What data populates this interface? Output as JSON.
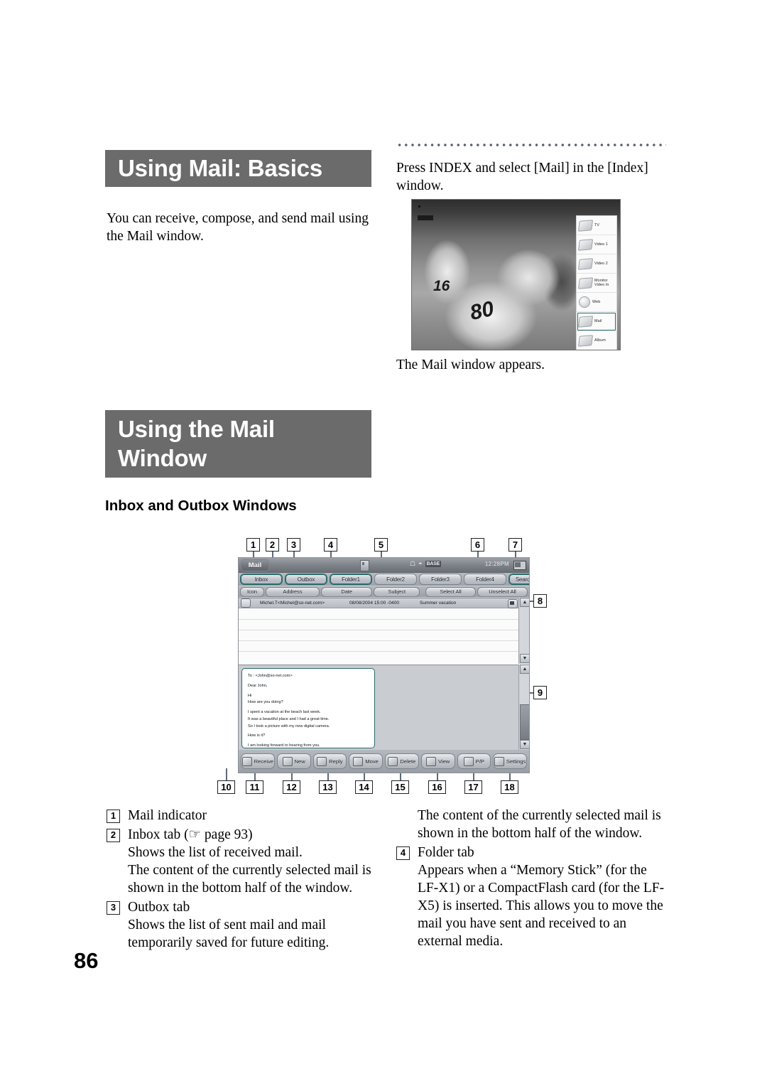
{
  "page": {
    "number": "86"
  },
  "headings": {
    "basics": "Using Mail: Basics",
    "window_line1": "Using the Mail",
    "window_line2": "Window",
    "sub": "Inbox and Outbox Windows"
  },
  "paragraphs": {
    "intro": "You can receive, compose, and send mail using the Mail window.",
    "press_index": "Press INDEX and select [Mail] in the [Index] window.",
    "mail_appears": "The Mail window appears."
  },
  "index_menu": {
    "items": [
      {
        "label": "TV",
        "icon": "tv-icon",
        "selected": false
      },
      {
        "label": "Video 1",
        "icon": "video-icon",
        "selected": false
      },
      {
        "label": "Video 2",
        "icon": "video-icon",
        "selected": false
      },
      {
        "label": "Monitor Video In",
        "icon": "monitor-icon",
        "selected": false
      },
      {
        "label": "Web",
        "icon": "globe-icon",
        "selected": false
      },
      {
        "label": "Mail",
        "icon": "mail-icon",
        "selected": true
      },
      {
        "label": "Album",
        "icon": "album-icon",
        "selected": false
      }
    ]
  },
  "tv_photo": {
    "player_number_left": "16",
    "player_number_front": "80"
  },
  "mail_window": {
    "indicator": "Mail",
    "clock": "12:28PM",
    "base_badge": "BASE",
    "tabs": [
      {
        "label": "Inbox",
        "active": true
      },
      {
        "label": "Outbox",
        "active": true
      },
      {
        "label": "Folder1",
        "active": true
      },
      {
        "label": "Folder2",
        "active": false
      },
      {
        "label": "Folder3",
        "active": false
      },
      {
        "label": "Folder4",
        "active": false
      }
    ],
    "search_tab": "Search",
    "columns": {
      "icon": "Icon",
      "address": "Address",
      "date": "Date",
      "subject": "Subject",
      "select_all": "Select All",
      "unselect_all": "Unselect All"
    },
    "rows": [
      {
        "address": "Michel.T<Michel@so-net.com>",
        "date": "08/08/2004 15:00 -0400",
        "subject": "Summer vacation"
      }
    ],
    "preview": {
      "to": "To : <John@so-net.com>",
      "greeting": "Dear John,",
      "l1": "Hi",
      "l2": "How are you doing?",
      "l3": "I spent a vacation at the beach last week.",
      "l4": "It was a beautiful place and I had a great time.",
      "l5": "So I took a picture with my new digital camera.",
      "l6": "How is it?",
      "l7": "I am looking forward to hearing from you."
    },
    "toolbar": [
      {
        "label": "Receive",
        "icon": "receive-icon"
      },
      {
        "label": "New",
        "icon": "new-icon"
      },
      {
        "label": "Reply",
        "icon": "reply-icon"
      },
      {
        "label": "Move",
        "icon": "move-icon"
      },
      {
        "label": "Delete",
        "icon": "delete-icon"
      },
      {
        "label": "View",
        "icon": "view-icon"
      },
      {
        "label": "P/P",
        "icon": "pip-icon"
      },
      {
        "label": "Settings",
        "icon": "settings-icon"
      }
    ]
  },
  "callouts": {
    "top": [
      "1",
      "2",
      "3",
      "4",
      "5",
      "6",
      "7"
    ],
    "right": [
      "8",
      "9"
    ],
    "bottom": [
      "10",
      "11",
      "12",
      "13",
      "14",
      "15",
      "16",
      "17",
      "18"
    ]
  },
  "legend_left": [
    {
      "num": "1",
      "title": "Mail indicator",
      "lines": []
    },
    {
      "num": "2",
      "title": "Inbox tab (☞ page 93)",
      "lines": [
        "Shows the list of received mail.",
        "The content of the currently selected mail is",
        "shown in the bottom half of the window."
      ]
    },
    {
      "num": "3",
      "title": "Outbox tab",
      "lines": [
        "Shows the list of sent mail and mail",
        "temporarily saved for future editing."
      ]
    }
  ],
  "legend_right": [
    {
      "num": "",
      "title": "",
      "lines": [
        "The content of the currently selected mail is",
        "shown in the bottom half of the window."
      ]
    },
    {
      "num": "4",
      "title": "Folder tab",
      "lines": [
        "Appears when a “Memory Stick” (for the",
        "LF-X1) or a CompactFlash card (for the LF-",
        "X5) is inserted. This allows you to move the",
        "mail you have sent and received to an",
        "external media."
      ]
    }
  ]
}
